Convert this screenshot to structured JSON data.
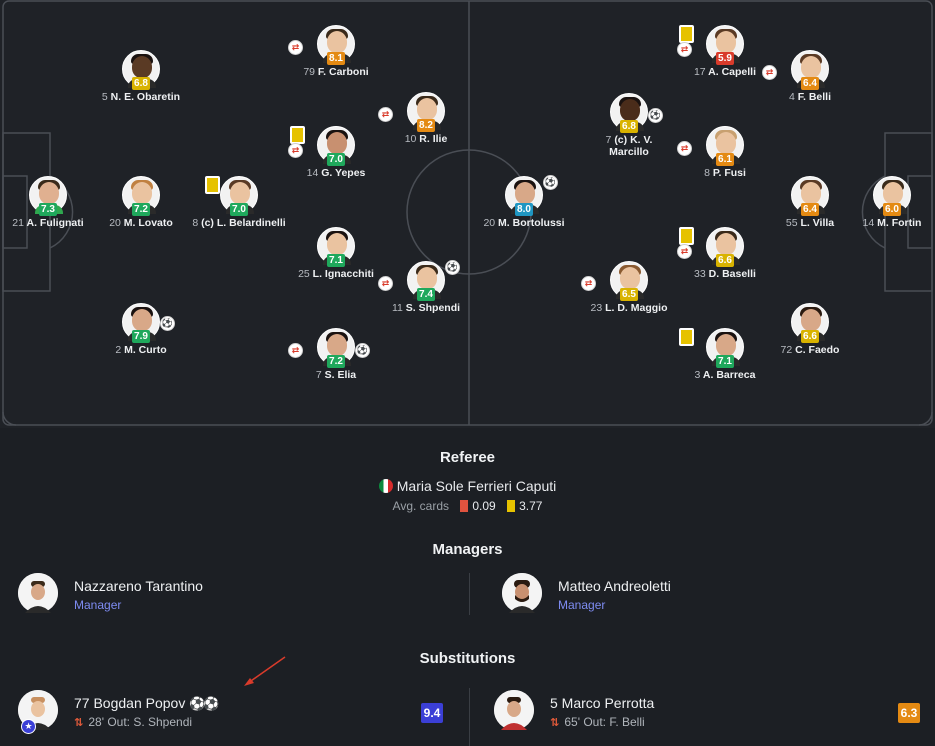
{
  "players": [
    {
      "id": "fulignati",
      "num": "21",
      "name": "A. Fulignati",
      "rating": "7.3",
      "rc": "green",
      "skin": "#e0b090",
      "shirt": "#2fa84f",
      "hair": "#3a2a1a"
    },
    {
      "id": "lovato",
      "num": "20",
      "name": "M. Lovato",
      "rating": "7.2",
      "rc": "green",
      "skin": "#eac3a0",
      "shirt": "#2a2a2a",
      "hair": "#c08040"
    },
    {
      "id": "obaretin",
      "num": "5",
      "name": "N. E. Obaretin",
      "rating": "6.8",
      "rc": "yellow",
      "skin": "#5a3a24",
      "shirt": "#2a2a2a",
      "hair": "#1a1210"
    },
    {
      "id": "curto",
      "num": "2",
      "name": "M. Curto",
      "rating": "7.9",
      "rc": "green",
      "skin": "#d8a888",
      "shirt": "#2a2a2a",
      "hair": "#1a1210"
    },
    {
      "id": "belardinelli",
      "num": "8",
      "name": "(c) L. Belardinelli",
      "rating": "7.0",
      "rc": "green",
      "skin": "#eac3a0",
      "shirt": "#2a2a2a",
      "hair": "#5a3a24"
    },
    {
      "id": "carboni",
      "num": "79",
      "name": "F. Carboni",
      "rating": "8.1",
      "rc": "orange",
      "skin": "#eac3a0",
      "shirt": "#2a2a2a",
      "hair": "#3a2a1a"
    },
    {
      "id": "yepes",
      "num": "14",
      "name": "G. Yepes",
      "rating": "7.0",
      "rc": "green",
      "skin": "#c89070",
      "shirt": "#2a2a2a",
      "hair": "#1a1210"
    },
    {
      "id": "ignacchiti",
      "num": "25",
      "name": "L. Ignacchiti",
      "rating": "7.1",
      "rc": "green",
      "skin": "#eac3a0",
      "shirt": "#2a2a2a",
      "hair": "#1a1210"
    },
    {
      "id": "elia",
      "num": "7",
      "name": "S. Elia",
      "rating": "7.2",
      "rc": "green",
      "skin": "#d8a888",
      "shirt": "#2a2a2a",
      "hair": "#1a1210"
    },
    {
      "id": "ilie",
      "num": "10",
      "name": "R. Ilie",
      "rating": "8.2",
      "rc": "orange",
      "skin": "#eac3a0",
      "shirt": "#2a2a2a",
      "hair": "#3a2a1a"
    },
    {
      "id": "shpendi",
      "num": "11",
      "name": "S. Shpendi",
      "rating": "7.4",
      "rc": "green",
      "skin": "#eac3a0",
      "shirt": "#2a2a2a",
      "hair": "#3a2a1a"
    },
    {
      "id": "bortolussi",
      "num": "20",
      "name": "M. Bortolussi",
      "rating": "8.0",
      "rc": "blue",
      "skin": "#d8a888",
      "shirt": "#2a2a2a",
      "hair": "#1a1210"
    },
    {
      "id": "marcillo",
      "num": "7",
      "name": "(c) K. V. Marcillo",
      "rating": "6.8",
      "rc": "yellow",
      "skin": "#4a2c1a",
      "shirt": "#2a2a2a",
      "hair": "#1a1210"
    },
    {
      "id": "maggio",
      "num": "23",
      "name": "L. D. Maggio",
      "rating": "6.5",
      "rc": "yellow",
      "skin": "#eac3a0",
      "shirt": "#2a2a2a",
      "hair": "#8a5a30"
    },
    {
      "id": "capelli",
      "num": "17",
      "name": "A. Capelli",
      "rating": "5.9",
      "rc": "red",
      "skin": "#eac3a0",
      "shirt": "#2a2a2a",
      "hair": "#5a3a24"
    },
    {
      "id": "fusi",
      "num": "8",
      "name": "P. Fusi",
      "rating": "6.1",
      "rc": "orange",
      "skin": "#eac3a0",
      "shirt": "#2a2a2a",
      "hair": "#c8a070"
    },
    {
      "id": "baselli",
      "num": "33",
      "name": "D. Baselli",
      "rating": "6.6",
      "rc": "yellow",
      "skin": "#eac3a0",
      "shirt": "#2a2a2a",
      "hair": "#3a2a1a"
    },
    {
      "id": "barreca",
      "num": "3",
      "name": "A. Barreca",
      "rating": "7.1",
      "rc": "green",
      "skin": "#d8a888",
      "shirt": "#2a2a2a",
      "hair": "#1a1210"
    },
    {
      "id": "belli",
      "num": "4",
      "name": "F. Belli",
      "rating": "6.4",
      "rc": "orange",
      "skin": "#eac3a0",
      "shirt": "#2a2a2a",
      "hair": "#5a3a24"
    },
    {
      "id": "villa",
      "num": "55",
      "name": "L. Villa",
      "rating": "6.4",
      "rc": "orange",
      "skin": "#eac3a0",
      "shirt": "#2a2a2a",
      "hair": "#5a3a24"
    },
    {
      "id": "faedo",
      "num": "72",
      "name": "C. Faedo",
      "rating": "6.6",
      "rc": "yellow",
      "skin": "#d8a888",
      "shirt": "#2a2a2a",
      "hair": "#2a1a10"
    },
    {
      "id": "fortin",
      "num": "14",
      "name": "M. Fortin",
      "rating": "6.0",
      "rc": "orange",
      "skin": "#eac3a0",
      "shirt": "#2a2a2a",
      "hair": "#3a2a1a"
    }
  ],
  "colors": {
    "green": "#1fa85c",
    "orange": "#e48a13",
    "yellow": "#d9b300",
    "red": "#d93b2b",
    "blue": "#1f96c2",
    "purple": "#3b3fd6",
    "manager_role": "#7e8cf2",
    "red_card": "#e0533f",
    "yellow_card": "#e6c200"
  },
  "referee": {
    "title": "Referee",
    "name": "Maria Sole Ferrieri Caputi",
    "avg_label": "Avg. cards",
    "red_avg": "0.09",
    "yellow_avg": "3.77"
  },
  "managers": {
    "title": "Managers",
    "home": {
      "name": "Nazzareno Tarantino",
      "role": "Manager"
    },
    "away": {
      "name": "Matteo Andreoletti",
      "role": "Manager"
    }
  },
  "substitutions": {
    "title": "Substitutions",
    "home": {
      "name": "77 Bogdan Popov",
      "detail": "28' Out: S. Shpendi",
      "rating": "9.4",
      "icons": "goal-icon ×2"
    },
    "away": {
      "name": "5 Marco Perrotta",
      "detail": "65' Out: F. Belli",
      "rating": "6.3"
    }
  }
}
